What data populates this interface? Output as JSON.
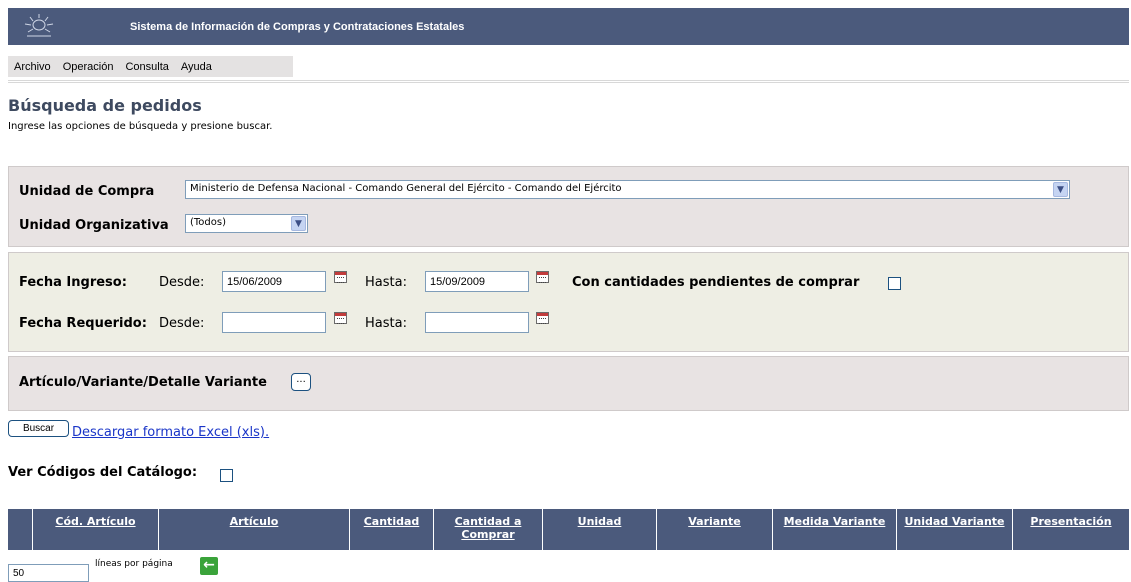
{
  "header": {
    "title": "Sistema de Información de Compras y Contrataciones Estatales"
  },
  "menu": [
    "Archivo",
    "Operación",
    "Consulta",
    "Ayuda"
  ],
  "page": {
    "title": "Búsqueda de pedidos",
    "subtitle": "Ingrese las opciones de búsqueda y presione buscar."
  },
  "form": {
    "unidad_compra_label": "Unidad de Compra",
    "unidad_compra_value": "Ministerio de Defensa Nacional - Comando General del Ejército - Comando del Ejército",
    "unidad_org_label": "Unidad Organizativa",
    "unidad_org_value": "(Todos)",
    "fecha_ingreso_label": "Fecha Ingreso:",
    "desde_label": "Desde:",
    "hasta_label": "Hasta:",
    "fecha_ingreso_desde": "15/06/2009",
    "fecha_ingreso_hasta": "15/09/2009",
    "pendientes_label": "Con cantidades pendientes de comprar",
    "fecha_requerido_label": "Fecha Requerido:",
    "fecha_requerido_desde": "",
    "fecha_requerido_hasta": "",
    "articulo_label": "Artículo/Variante/Detalle Variante",
    "dots_label": "..."
  },
  "actions": {
    "buscar_label": "Buscar",
    "excel_link": "Descargar formato Excel (xls)."
  },
  "catalog": {
    "ver_codigos_label": "Ver Códigos del Catálogo:"
  },
  "table": {
    "columns": [
      "Cód. Artículo",
      "Artículo",
      "Cantidad",
      "Cantidad a Comprar",
      "Unidad",
      "Variante",
      "Medida Variante",
      "Unidad Variante",
      "Presentación"
    ]
  },
  "pager": {
    "lines_value": "50",
    "lines_label": "líneas por página"
  },
  "colors": {
    "header_bg": "#4b5a7c",
    "panel_gray": "#e8e3e3",
    "panel_beige": "#eeeee4",
    "title_color": "#3e4a60",
    "link_color": "#1a35c8"
  }
}
